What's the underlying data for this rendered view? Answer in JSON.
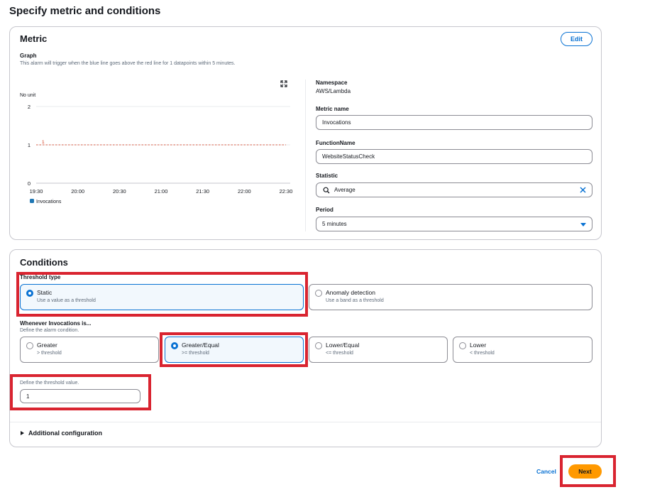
{
  "page": {
    "title": "Specify metric and conditions"
  },
  "metric": {
    "title": "Metric",
    "edit_label": "Edit",
    "graph": {
      "heading": "Graph",
      "description": "This alarm will trigger when the blue line goes above the red line for 1 datapoints within 5 minutes.",
      "expand_icon": "expand-icon"
    },
    "details": {
      "namespace_label": "Namespace",
      "namespace_value": "AWS/Lambda",
      "metric_name_label": "Metric name",
      "metric_name_value": "Invocations",
      "function_name_label": "FunctionName",
      "function_name_value": "WebsiteStatusCheck",
      "statistic_label": "Statistic",
      "statistic_value": "Average",
      "period_label": "Period",
      "period_value": "5 minutes"
    }
  },
  "chart_data": {
    "type": "line",
    "title": "",
    "ylabel": "No unit",
    "xlabel": "",
    "x_ticks": [
      "19:30",
      "20:00",
      "20:30",
      "21:00",
      "21:30",
      "22:00",
      "22:30"
    ],
    "y_ticks": [
      "0",
      "1",
      "2"
    ],
    "ylim": [
      0,
      2
    ],
    "threshold": {
      "value": 1,
      "label": "1",
      "color": "#d13212",
      "style": "dashed"
    },
    "series": [
      {
        "name": "Invocations",
        "color": "#1f77b4",
        "values": []
      }
    ],
    "legend_position": "bottom-left",
    "grid": true
  },
  "conditions": {
    "title": "Conditions",
    "threshold_type_label": "Threshold type",
    "threshold_types": [
      {
        "title": "Static",
        "desc": "Use a value as a threshold",
        "selected": true
      },
      {
        "title": "Anomaly detection",
        "desc": "Use a band as a threshold",
        "selected": false
      }
    ],
    "whenever_label": "Whenever Invocations is...",
    "whenever_desc": "Define the alarm condition.",
    "operators": [
      {
        "title": "Greater",
        "desc": "> threshold",
        "selected": false
      },
      {
        "title": "Greater/Equal",
        "desc": ">= threshold",
        "selected": true
      },
      {
        "title": "Lower/Equal",
        "desc": "<= threshold",
        "selected": false
      },
      {
        "title": "Lower",
        "desc": "< threshold",
        "selected": false
      }
    ],
    "than_desc": "Define the threshold value.",
    "threshold_value": "1",
    "additional_config_label": "Additional configuration"
  },
  "footer": {
    "cancel_label": "Cancel",
    "next_label": "Next"
  },
  "colors": {
    "accent": "#0972d3",
    "primary_button": "#ff9900",
    "highlight": "#d92430"
  }
}
